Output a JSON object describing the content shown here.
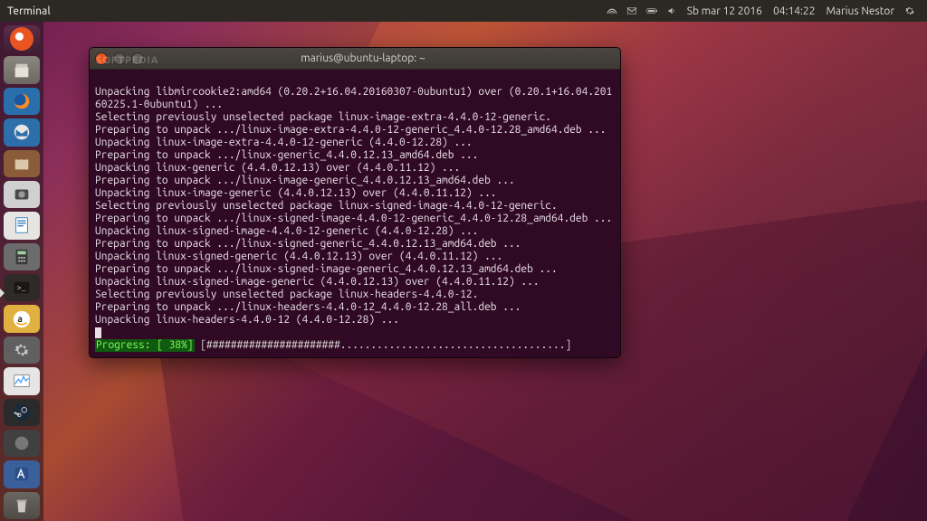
{
  "menubar": {
    "app_name": "Terminal",
    "date": "Sb mar 12 2016",
    "time": "04:14:22",
    "user": "Marius Nestor"
  },
  "launcher": {
    "items": [
      {
        "name": "dash-icon",
        "cls": "dash"
      },
      {
        "name": "files-icon",
        "cls": "files"
      },
      {
        "name": "firefox-icon",
        "cls": "firefox"
      },
      {
        "name": "thunderbird-icon",
        "cls": "thunderbird"
      },
      {
        "name": "software-icon",
        "cls": "software"
      },
      {
        "name": "photos-icon",
        "cls": "photos"
      },
      {
        "name": "writer-icon",
        "cls": "writer"
      },
      {
        "name": "calc-icon",
        "cls": "calc"
      },
      {
        "name": "terminal-icon",
        "cls": "terminal",
        "running": true
      },
      {
        "name": "amazon-icon",
        "cls": "amazon"
      },
      {
        "name": "settings-icon",
        "cls": "settings"
      },
      {
        "name": "system-monitor-icon",
        "cls": "monitor"
      },
      {
        "name": "steam-icon",
        "cls": "steam"
      },
      {
        "name": "app-icon",
        "cls": "generic"
      },
      {
        "name": "virtualbox-icon",
        "cls": "vbox"
      },
      {
        "name": "trash-icon",
        "cls": "trash"
      }
    ]
  },
  "terminal": {
    "title": "marius@ubuntu-laptop: ~",
    "lines": [
      "",
      "Unpacking libmircookie2:amd64 (0.20.2+16.04.20160307-0ubuntu1) over (0.20.1+16.04.20160225.1-0ubuntu1) ...",
      "Selecting previously unselected package linux-image-extra-4.4.0-12-generic.",
      "Preparing to unpack .../linux-image-extra-4.4.0-12-generic_4.4.0-12.28_amd64.deb ...",
      "Unpacking linux-image-extra-4.4.0-12-generic (4.4.0-12.28) ...",
      "Preparing to unpack .../linux-generic_4.4.0.12.13_amd64.deb ...",
      "Unpacking linux-generic (4.4.0.12.13) over (4.4.0.11.12) ...",
      "Preparing to unpack .../linux-image-generic_4.4.0.12.13_amd64.deb ...",
      "Unpacking linux-image-generic (4.4.0.12.13) over (4.4.0.11.12) ...",
      "Selecting previously unselected package linux-signed-image-4.4.0-12-generic.",
      "Preparing to unpack .../linux-signed-image-4.4.0-12-generic_4.4.0-12.28_amd64.deb ...",
      "Unpacking linux-signed-image-4.4.0-12-generic (4.4.0-12.28) ...",
      "Preparing to unpack .../linux-signed-generic_4.4.0.12.13_amd64.deb ...",
      "Unpacking linux-signed-generic (4.4.0.12.13) over (4.4.0.11.12) ...",
      "Preparing to unpack .../linux-signed-image-generic_4.4.0.12.13_amd64.deb ...",
      "Unpacking linux-signed-image-generic (4.4.0.12.13) over (4.4.0.11.12) ...",
      "Selecting previously unselected package linux-headers-4.4.0-12.",
      "Preparing to unpack .../linux-headers-4.4.0-12_4.4.0-12.28_all.deb ...",
      "Unpacking linux-headers-4.4.0-12 (4.4.0-12.28) ..."
    ],
    "progress_label": "Progress: [ 38%]",
    "progress_bar": "[######################.....................................]"
  },
  "watermark": "SOFTPEDIA"
}
